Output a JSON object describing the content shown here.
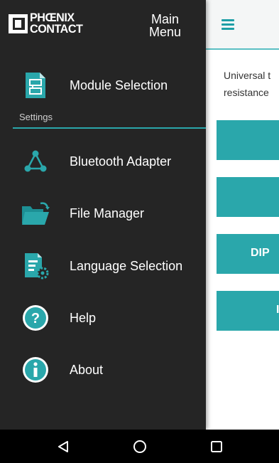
{
  "app": {
    "description_line1": "Universal t",
    "description_line2": "resistance",
    "buttons": [
      "",
      "",
      "DIP",
      "I"
    ]
  },
  "drawer": {
    "logo_line1": "PHŒNIX",
    "logo_line2": "CONTACT",
    "title_line1": "Main",
    "title_line2": "Menu",
    "items": [
      {
        "label": "Module Selection",
        "icon": "module-icon"
      },
      {
        "label": "Bluetooth Adapter",
        "icon": "bluetooth-adapter-icon"
      },
      {
        "label": "File Manager",
        "icon": "folder-icon"
      },
      {
        "label": "Language Selection",
        "icon": "language-selection-icon"
      },
      {
        "label": "Help",
        "icon": "help-icon"
      },
      {
        "label": "About",
        "icon": "info-icon"
      }
    ],
    "section_label": "Settings"
  },
  "colors": {
    "accent": "#2aa7ab",
    "drawer_bg": "#252525",
    "navbar_bg": "#000000"
  },
  "navbar": {
    "back": "back-icon",
    "home": "home-icon",
    "recents": "recents-icon"
  }
}
